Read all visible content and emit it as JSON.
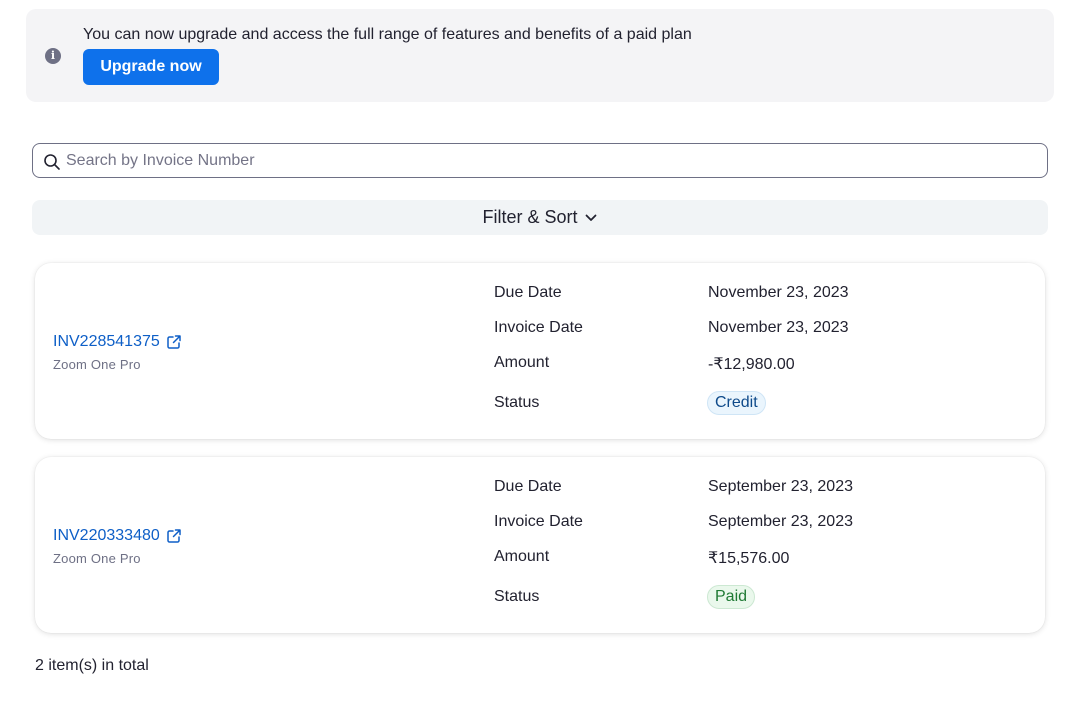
{
  "banner": {
    "icon": "info-icon",
    "message": "You can now upgrade and access the full range of features and benefits of a paid plan",
    "button_label": "Upgrade now",
    "button_color": "#0e71eb"
  },
  "search": {
    "icon": "search-icon",
    "placeholder": "Search by Invoice Number",
    "value": ""
  },
  "filter": {
    "label": "Filter & Sort",
    "icon": "chevron-down-icon"
  },
  "invoices": [
    {
      "number": "INV228541375",
      "plan": "Zoom One Pro",
      "due_date_label": "Due Date",
      "due_date": "November 23, 2023",
      "invoice_date_label": "Invoice Date",
      "invoice_date": "November 23, 2023",
      "amount_label": "Amount",
      "amount": "-₹12,980.00",
      "status_label": "Status",
      "status": "Credit"
    },
    {
      "number": "INV220333480",
      "plan": "Zoom One Pro",
      "due_date_label": "Due Date",
      "due_date": "September 23, 2023",
      "invoice_date_label": "Invoice Date",
      "invoice_date": "September 23, 2023",
      "amount_label": "Amount",
      "amount": "₹15,576.00",
      "status_label": "Status",
      "status": "Paid"
    }
  ],
  "footer": {
    "total_text": "2 item(s) in total"
  },
  "colors": {
    "link": "#0e5fc7",
    "credit_badge": "#eaf5fd",
    "paid_badge": "#eaf8ec"
  }
}
